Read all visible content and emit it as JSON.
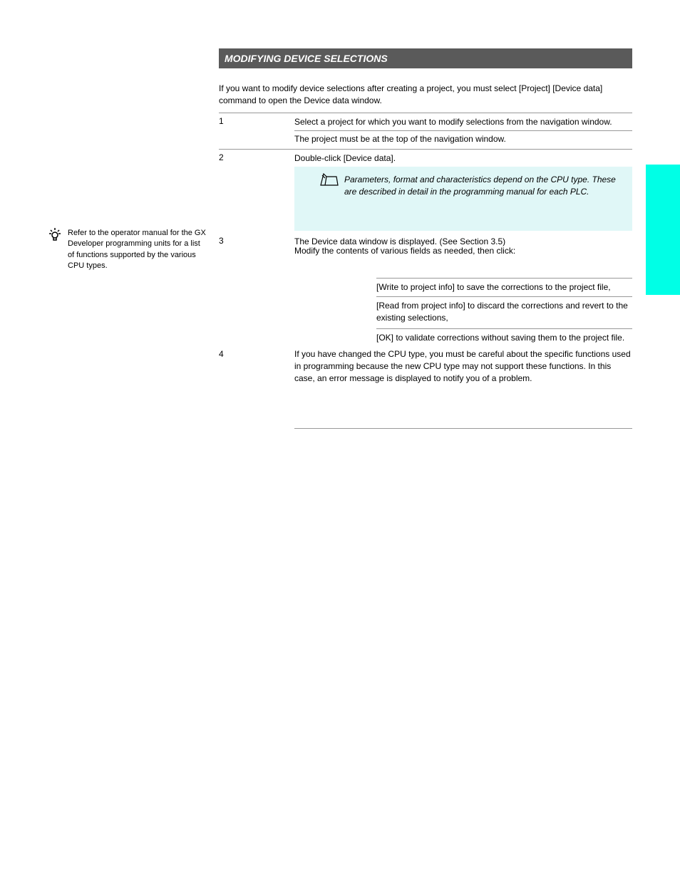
{
  "header": "MODIFYING DEVICE SELECTIONS",
  "intro": "If you want to modify device selections after creating a project, you must select [Project] [Device data] command to open the Device data window.",
  "steps": {
    "s1": {
      "num": "1",
      "text": "Select a project for which you want to modify selections from the navigation window."
    },
    "s1sub": "The project must be at the top of the navigation window.",
    "s2": {
      "num": "2",
      "text": "Double-click [Device data]."
    },
    "s3": {
      "num": "3",
      "text": "The Device data window is displayed. (See Section 3.5)"
    },
    "s3_desc": "Modify the contents of various fields as needed, then click:",
    "s3_options": {
      "a": "[Write to project info] to save the corrections to the project file,",
      "b": "[Read from project info] to discard the corrections and revert to the existing selections,",
      "c": "[OK] to validate corrections without saving them to the project file."
    },
    "s4": {
      "num": "4",
      "text": "If you have changed the CPU type, you must be careful about the specific functions used in programming because the new CPU type may not support these functions. In this case, an error message is displayed to notify you of a problem."
    }
  },
  "note": "Parameters, format and characteristics depend on the CPU type. These are described in detail in the programming manual for each PLC.",
  "tip": "Refer to the operator manual for the GX Developer programming units for a list of functions supported by the various CPU types."
}
